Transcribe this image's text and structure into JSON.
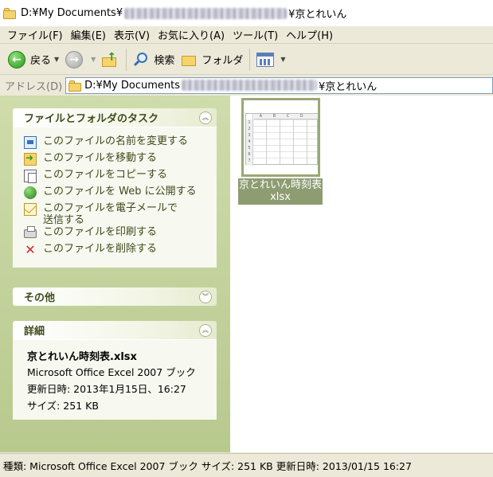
{
  "window": {
    "title_prefix": "D:¥My Documents¥",
    "title_suffix": "¥京とれいん"
  },
  "menu": [
    {
      "label": "ファイル(F)"
    },
    {
      "label": "編集(E)"
    },
    {
      "label": "表示(V)"
    },
    {
      "label": "お気に入り(A)"
    },
    {
      "label": "ツール(T)"
    },
    {
      "label": "ヘルプ(H)"
    }
  ],
  "toolbar": {
    "back_label": "戻る",
    "search_label": "検索",
    "folders_label": "フォルダ"
  },
  "address": {
    "label": "アドレス(D)",
    "path_prefix": "D:¥My Documents",
    "path_suffix": "¥京とれいん"
  },
  "tasks_panel": {
    "title": "ファイルとフォルダのタスク",
    "items": [
      {
        "label": "このファイルの名前を変更する",
        "icon": "rename-icon"
      },
      {
        "label": "このファイルを移動する",
        "icon": "move-icon"
      },
      {
        "label": "このファイルをコピーする",
        "icon": "copy-icon"
      },
      {
        "label": "このファイルを Web に公開する",
        "icon": "web-publish-icon"
      },
      {
        "label": "このファイルを電子メールで送信する",
        "icon": "email-icon"
      },
      {
        "label": "このファイルを印刷する",
        "icon": "print-icon"
      },
      {
        "label": "このファイルを削除する",
        "icon": "delete-icon"
      }
    ]
  },
  "other_panel": {
    "title": "その他"
  },
  "details_panel": {
    "title": "詳細",
    "file_name": "京とれいん時刻表.xlsx",
    "file_type": "Microsoft Office Excel 2007 ブック",
    "modified": "更新日時: 2013年1月15日、16:27",
    "size": "サイズ: 251 KB"
  },
  "file": {
    "name_line1": "京とれいん時刻表",
    "name_line2": "xlsx",
    "thumb_cols": [
      "A",
      "B",
      "C",
      "D"
    ],
    "thumb_rows": [
      "1",
      "2",
      "3",
      "4",
      "5",
      "6",
      "7"
    ]
  },
  "statusbar": {
    "text": "種類: Microsoft Office Excel 2007 ブック サイズ: 251 KB 更新日時: 2013/01/15 16:27"
  },
  "colors": {
    "pane_green": "#b8c98e",
    "selection": "#8e9c72",
    "task_text": "#3c4a1a"
  }
}
